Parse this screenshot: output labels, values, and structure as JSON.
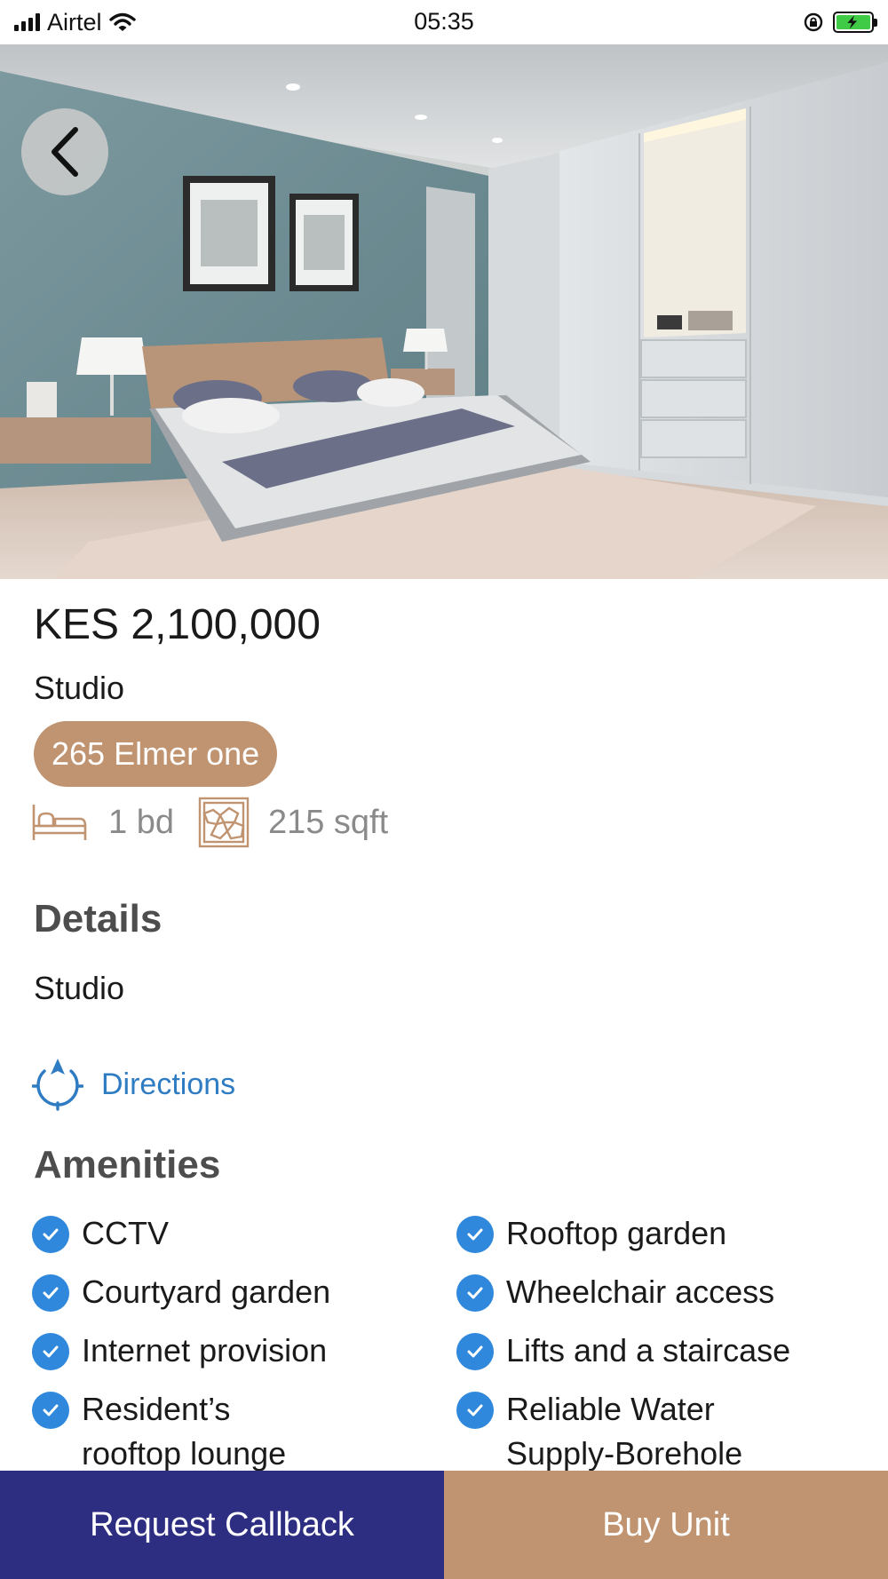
{
  "status_bar": {
    "carrier": "Airtel",
    "time": "05:35"
  },
  "listing": {
    "price": "KES 2,100,000",
    "unit_type": "Studio",
    "project_name": "265 Elmer one",
    "bedrooms": "1 bd",
    "area": "215 sqft"
  },
  "details": {
    "title": "Details",
    "text": "Studio"
  },
  "directions": {
    "label": "Directions"
  },
  "amenities": {
    "title": "Amenities",
    "items": [
      "CCTV",
      "Rooftop garden",
      "Courtyard garden",
      "Wheelchair access",
      "Internet provision",
      "Lifts and a staircase",
      "Resident’s rooftop lounge",
      "Reliable Water Supply-Borehole"
    ]
  },
  "actions": {
    "request_callback": "Request Callback",
    "buy_unit": "Buy Unit"
  },
  "colors": {
    "accent_tan": "#c09470",
    "navy": "#2d2d82",
    "link_blue": "#2f7cc3",
    "check_blue": "#2f88dc"
  },
  "icons": {
    "back": "chevron-left-icon",
    "bed": "bed-icon",
    "area": "floor-plan-icon",
    "directions": "compass-icon",
    "check": "check-circle-icon"
  }
}
